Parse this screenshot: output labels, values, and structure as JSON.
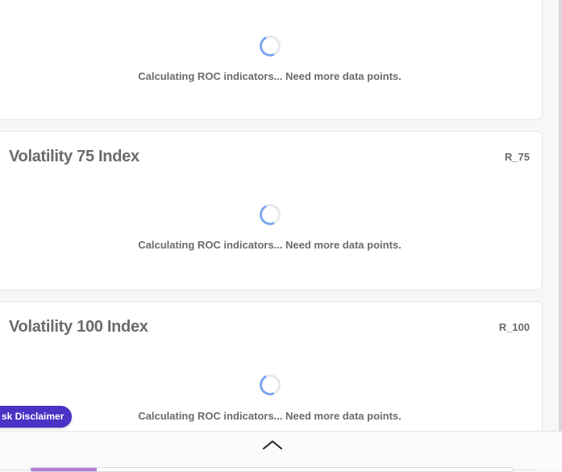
{
  "cards": [
    {
      "title": "",
      "symbol": "",
      "status": "Calculating ROC indicators... Need more data points."
    },
    {
      "title": "Volatility 75 Index",
      "symbol": "R_75",
      "status": "Calculating ROC indicators... Need more data points."
    },
    {
      "title": "Volatility 100 Index",
      "symbol": "R_100",
      "status": "Calculating ROC indicators... Need more data points."
    }
  ],
  "disclaimer": {
    "label": "sk Disclaimer"
  },
  "footer": {
    "toggle_icon": "chevron-up-icon"
  },
  "colors": {
    "accent": "#4b31c4",
    "spinner": "#7aa7f0",
    "tab": "#b07fd6"
  }
}
